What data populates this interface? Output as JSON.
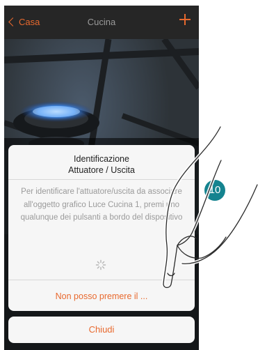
{
  "navbar": {
    "back_label": "Casa",
    "title": "Cucina",
    "add_icon": "plus-icon"
  },
  "background": {
    "subject": "gas stove burner with blue flame"
  },
  "dialog": {
    "title": "Identificazione\nAttuatore / Uscita",
    "message": "Per identificare l'attuatore/uscita da associare all'oggetto grafico Luce Cucina 1, premi uno qualunque dei pulsanti a bordo del dispositivo",
    "spinner_icon": "spinner-icon",
    "action_label": "Non posso premere il ..."
  },
  "close_button": {
    "label": "Chiudi"
  },
  "step_badge": {
    "number": "10"
  },
  "colors": {
    "accent": "#e8692e",
    "badge": "#14838f",
    "navbar": "#262626"
  }
}
